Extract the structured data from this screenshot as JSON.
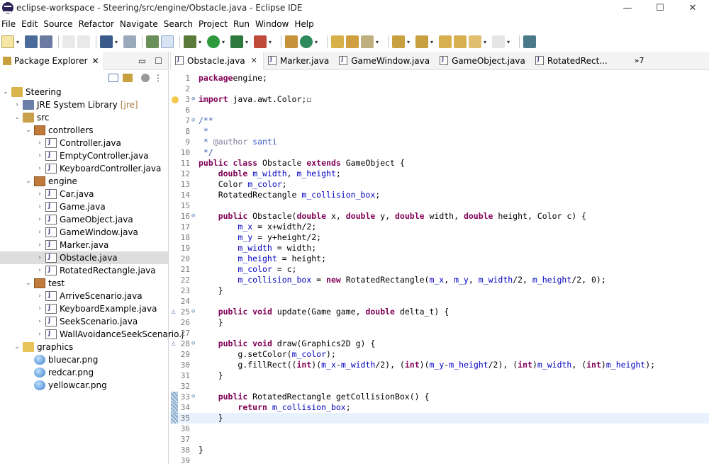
{
  "window": {
    "title": "eclipse-workspace - Steering/src/engine/Obstacle.java - Eclipse IDE",
    "minimize": "—",
    "maximize": "☐",
    "close": "✕"
  },
  "menu": [
    "File",
    "Edit",
    "Source",
    "Refactor",
    "Navigate",
    "Search",
    "Project",
    "Run",
    "Window",
    "Help"
  ],
  "package_explorer": {
    "title": "Package Explorer",
    "tree": [
      {
        "level": 0,
        "arrow": "down",
        "icon": "project",
        "label": "Steering"
      },
      {
        "level": 1,
        "arrow": "right",
        "icon": "library",
        "label": "JRE System Library",
        "suffix": "[jre]"
      },
      {
        "level": 1,
        "arrow": "down",
        "icon": "source-folder",
        "label": "src"
      },
      {
        "level": 2,
        "arrow": "down",
        "icon": "package",
        "label": "controllers"
      },
      {
        "level": 3,
        "arrow": "right",
        "icon": "java-file",
        "label": "Controller.java"
      },
      {
        "level": 3,
        "arrow": "right",
        "icon": "java-file",
        "label": "EmptyController.java"
      },
      {
        "level": 3,
        "arrow": "right",
        "icon": "java-file",
        "label": "KeyboardController.java"
      },
      {
        "level": 2,
        "arrow": "down",
        "icon": "package",
        "label": "engine"
      },
      {
        "level": 3,
        "arrow": "right",
        "icon": "java-file",
        "label": "Car.java"
      },
      {
        "level": 3,
        "arrow": "right",
        "icon": "java-file",
        "label": "Game.java"
      },
      {
        "level": 3,
        "arrow": "right",
        "icon": "java-file",
        "label": "GameObject.java"
      },
      {
        "level": 3,
        "arrow": "right",
        "icon": "java-file",
        "label": "GameWindow.java"
      },
      {
        "level": 3,
        "arrow": "right",
        "icon": "java-file",
        "label": "Marker.java"
      },
      {
        "level": 3,
        "arrow": "right",
        "icon": "java-file",
        "label": "Obstacle.java",
        "selected": true
      },
      {
        "level": 3,
        "arrow": "right",
        "icon": "java-file",
        "label": "RotatedRectangle.java"
      },
      {
        "level": 2,
        "arrow": "down",
        "icon": "package",
        "label": "test"
      },
      {
        "level": 3,
        "arrow": "right",
        "icon": "java-file",
        "label": "ArriveScenario.java"
      },
      {
        "level": 3,
        "arrow": "right",
        "icon": "java-file",
        "label": "KeyboardExample.java"
      },
      {
        "level": 3,
        "arrow": "right",
        "icon": "java-file",
        "label": "SeekScenario.java"
      },
      {
        "level": 3,
        "arrow": "right",
        "icon": "java-file",
        "label": "WallAvoidanceSeekScenario.j"
      },
      {
        "level": 1,
        "arrow": "down",
        "icon": "folder",
        "label": "graphics"
      },
      {
        "level": 2,
        "arrow": "",
        "icon": "png-file",
        "label": "bluecar.png"
      },
      {
        "level": 2,
        "arrow": "",
        "icon": "png-file",
        "label": "redcar.png"
      },
      {
        "level": 2,
        "arrow": "",
        "icon": "png-file",
        "label": "yellowcar.png"
      }
    ]
  },
  "editor_tabs": [
    {
      "label": "Obstacle.java",
      "active": true
    },
    {
      "label": "Marker.java"
    },
    {
      "label": "GameWindow.java"
    },
    {
      "label": "GameObject.java"
    },
    {
      "label": "RotatedRect..."
    }
  ],
  "tabs_overflow": "»7",
  "code": [
    {
      "n": "1",
      "t": [
        [
          "kw",
          "package"
        ],
        [
          "",
          "engine;"
        ]
      ]
    },
    {
      "n": "2",
      "t": []
    },
    {
      "n": "3",
      "mark": "warn",
      "fold": "⊕",
      "t": [
        [
          "kw",
          "import"
        ],
        [
          "",
          " java.awt.Color;"
        ],
        [
          "",
          "☐"
        ]
      ]
    },
    {
      "n": "6",
      "t": []
    },
    {
      "n": "7",
      "fold": "⊖",
      "t": [
        [
          "cm",
          "/**"
        ]
      ]
    },
    {
      "n": "8",
      "t": [
        [
          "cm",
          " *"
        ]
      ]
    },
    {
      "n": "9",
      "t": [
        [
          "cm",
          " * "
        ],
        [
          "ann",
          "@author"
        ],
        [
          "cm",
          " santi"
        ]
      ]
    },
    {
      "n": "10",
      "t": [
        [
          "cm",
          " */"
        ]
      ]
    },
    {
      "n": "11",
      "t": [
        [
          "kw",
          "public class"
        ],
        [
          "",
          " Obstacle "
        ],
        [
          "kw",
          "extends"
        ],
        [
          "",
          " GameObject {"
        ]
      ]
    },
    {
      "n": "12",
      "t": [
        [
          "",
          "    "
        ],
        [
          "kw",
          "double"
        ],
        [
          "",
          " "
        ],
        [
          "fld",
          "m_width"
        ],
        [
          "",
          ", "
        ],
        [
          "fld",
          "m_height"
        ],
        [
          "",
          ";"
        ]
      ]
    },
    {
      "n": "13",
      "t": [
        [
          "",
          "    Color "
        ],
        [
          "fld",
          "m_color"
        ],
        [
          "",
          ";"
        ]
      ]
    },
    {
      "n": "14",
      "t": [
        [
          "",
          "    RotatedRectangle "
        ],
        [
          "fld",
          "m_collision_box"
        ],
        [
          "",
          ";"
        ]
      ]
    },
    {
      "n": "15",
      "t": []
    },
    {
      "n": "16",
      "fold": "⊖",
      "t": [
        [
          "",
          "    "
        ],
        [
          "kw",
          "public"
        ],
        [
          "",
          " Obstacle("
        ],
        [
          "kw",
          "double"
        ],
        [
          "",
          " x, "
        ],
        [
          "kw",
          "double"
        ],
        [
          "",
          " y, "
        ],
        [
          "kw",
          "double"
        ],
        [
          "",
          " width, "
        ],
        [
          "kw",
          "double"
        ],
        [
          "",
          " height, Color c) {"
        ]
      ]
    },
    {
      "n": "17",
      "t": [
        [
          "",
          "        "
        ],
        [
          "fld",
          "m_x"
        ],
        [
          "",
          " = x+width/2;"
        ]
      ]
    },
    {
      "n": "18",
      "t": [
        [
          "",
          "        "
        ],
        [
          "fld",
          "m_y"
        ],
        [
          "",
          " = y+height/2;"
        ]
      ]
    },
    {
      "n": "19",
      "t": [
        [
          "",
          "        "
        ],
        [
          "fld",
          "m_width"
        ],
        [
          "",
          " = width;"
        ]
      ]
    },
    {
      "n": "20",
      "t": [
        [
          "",
          "        "
        ],
        [
          "fld",
          "m_height"
        ],
        [
          "",
          " = height;"
        ]
      ]
    },
    {
      "n": "21",
      "t": [
        [
          "",
          "        "
        ],
        [
          "fld",
          "m_color"
        ],
        [
          "",
          " = c;"
        ]
      ]
    },
    {
      "n": "22",
      "t": [
        [
          "",
          "        "
        ],
        [
          "fld",
          "m_collision_box"
        ],
        [
          "",
          " = "
        ],
        [
          "kw",
          "new"
        ],
        [
          "",
          " RotatedRectangle("
        ],
        [
          "fld",
          "m_x"
        ],
        [
          "",
          ", "
        ],
        [
          "fld",
          "m_y"
        ],
        [
          "",
          ", "
        ],
        [
          "fld",
          "m_width"
        ],
        [
          "",
          "/2, "
        ],
        [
          "fld",
          "m_height"
        ],
        [
          "",
          "/2, 0);"
        ]
      ]
    },
    {
      "n": "23",
      "t": [
        [
          "",
          "    }"
        ]
      ]
    },
    {
      "n": "24",
      "t": []
    },
    {
      "n": "25",
      "mark": "override",
      "fold": "⊖",
      "t": [
        [
          "",
          "    "
        ],
        [
          "kw",
          "public void"
        ],
        [
          "",
          " update(Game game, "
        ],
        [
          "kw",
          "double"
        ],
        [
          "",
          " delta_t) {"
        ]
      ]
    },
    {
      "n": "26",
      "t": [
        [
          "",
          "    }"
        ]
      ]
    },
    {
      "n": "27",
      "t": []
    },
    {
      "n": "28",
      "mark": "override",
      "fold": "⊖",
      "t": [
        [
          "",
          "    "
        ],
        [
          "kw",
          "public void"
        ],
        [
          "",
          " draw(Graphics2D g) {"
        ]
      ]
    },
    {
      "n": "29",
      "t": [
        [
          "",
          "        g.setColor("
        ],
        [
          "fld",
          "m_color"
        ],
        [
          "",
          ");"
        ]
      ]
    },
    {
      "n": "30",
      "t": [
        [
          "",
          "        g.fillRect(("
        ],
        [
          "kw",
          "int"
        ],
        [
          "",
          ")("
        ],
        [
          "fld",
          "m_x"
        ],
        [
          "",
          "-"
        ],
        [
          "fld",
          "m_width"
        ],
        [
          "",
          "/2), ("
        ],
        [
          "kw",
          "int"
        ],
        [
          "",
          ")("
        ],
        [
          "fld",
          "m_y"
        ],
        [
          "",
          "-"
        ],
        [
          "fld",
          "m_height"
        ],
        [
          "",
          "/2), ("
        ],
        [
          "kw",
          "int"
        ],
        [
          "",
          ")"
        ],
        [
          "fld",
          "m_width"
        ],
        [
          "",
          ", ("
        ],
        [
          "kw",
          "int"
        ],
        [
          "",
          ")"
        ],
        [
          "fld",
          "m_height"
        ],
        [
          "",
          ");"
        ]
      ]
    },
    {
      "n": "31",
      "t": [
        [
          "",
          "    }"
        ]
      ]
    },
    {
      "n": "32",
      "t": []
    },
    {
      "n": "33",
      "mark": "block",
      "fold": "⊖",
      "t": [
        [
          "",
          "    "
        ],
        [
          "kw",
          "public"
        ],
        [
          "",
          " RotatedRectangle getCollisionBox() {"
        ]
      ]
    },
    {
      "n": "34",
      "mark": "block",
      "t": [
        [
          "",
          "        "
        ],
        [
          "kw",
          "return"
        ],
        [
          "",
          " "
        ],
        [
          "fld",
          "m_collision_box"
        ],
        [
          "",
          ";"
        ]
      ]
    },
    {
      "n": "35",
      "mark": "block",
      "highlight": true,
      "t": [
        [
          "",
          "    }"
        ]
      ]
    },
    {
      "n": "36",
      "t": []
    },
    {
      "n": "37",
      "t": []
    },
    {
      "n": "38",
      "t": [
        [
          "",
          "}"
        ]
      ]
    },
    {
      "n": "39",
      "t": []
    }
  ]
}
